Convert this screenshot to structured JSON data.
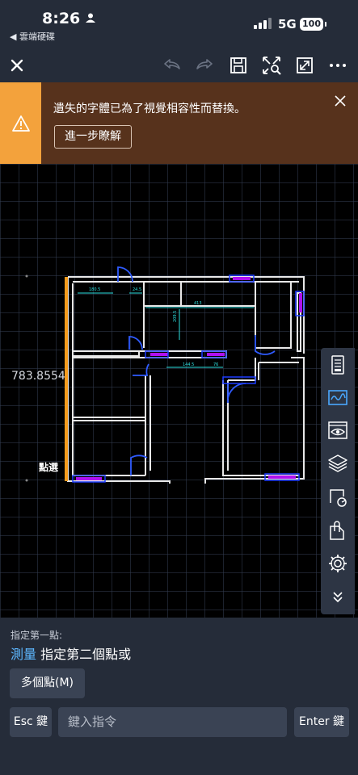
{
  "status_bar": {
    "time": "8:26",
    "back_app": "◀ 雲端硬碟",
    "network": "5G",
    "battery": "100"
  },
  "toolbar": {
    "close_icon": "close-icon",
    "undo_icon": "undo-icon",
    "redo_icon": "redo-icon",
    "save_icon": "save-icon",
    "zoom_fit_icon": "zoom-extents-icon",
    "fullscreen_icon": "fullscreen-icon",
    "more_icon": "more-icon"
  },
  "banner": {
    "message": "遺失的字體已為了視覺相容性而替換。",
    "learn_more": "進一步瞭解",
    "color_bg": "#57321c",
    "color_icon_bg": "#f3a23c"
  },
  "canvas": {
    "measure_value": "783.8554",
    "select_label": "點選",
    "dims": [
      "180.5",
      "24.5",
      "413",
      "209.5",
      "144.5",
      "76"
    ]
  },
  "side_tools": [
    "properties-icon",
    "markup-icon",
    "view-icon",
    "layers-icon",
    "measure-icon",
    "attachments-icon",
    "settings-icon",
    "collapse-icon"
  ],
  "command": {
    "prompt_line1": "指定第一點:",
    "prompt_keyword": "測量",
    "prompt_rest": " 指定第二個點或",
    "multi_points": "多個點(M)",
    "esc_label": "Esc 鍵",
    "input_placeholder": "鍵入指令",
    "enter_label": "Enter 鍵"
  }
}
